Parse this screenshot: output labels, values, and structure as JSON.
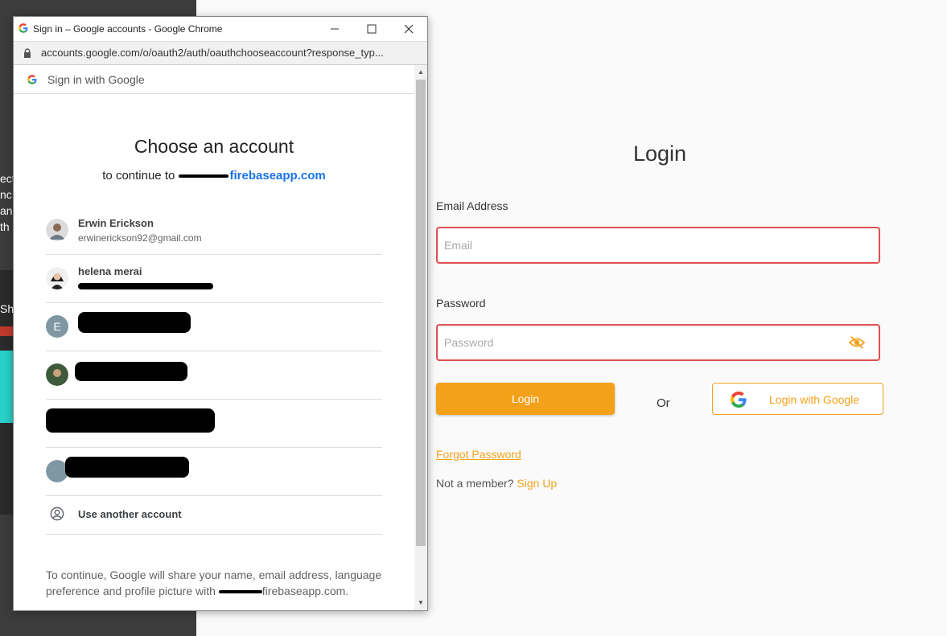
{
  "background": {
    "left_text_lines": [
      "ect",
      "nc",
      "an",
      "th"
    ],
    "tab_snippet": "Sh"
  },
  "login": {
    "title": "Login",
    "email_label": "Email Address",
    "email_placeholder": "Email",
    "password_label": "Password",
    "password_placeholder": "Password",
    "login_button": "Login",
    "or_text": "Or",
    "google_button": "Login with Google",
    "forgot_password": "Forgot Password",
    "not_member": "Not a member?",
    "sign_up": "Sign Up",
    "accent_color": "#f4a11a",
    "error_border_color": "#e05050"
  },
  "popup": {
    "window_title": "Sign in – Google accounts - Google Chrome",
    "url": "accounts.google.com/o/oauth2/auth/oauthchooseaccount?response_typ...",
    "header": "Sign in with Google",
    "heading": "Choose an account",
    "continue_prefix": "to continue to",
    "continue_app": "firebaseapp.com",
    "accounts": [
      {
        "name": "Erwin Erickson",
        "email": "erwinerickson92@gmail.com"
      },
      {
        "name": "helena merai",
        "email": ""
      },
      {
        "name": "",
        "email": "",
        "initial": "E"
      },
      {
        "name": "",
        "email": ""
      },
      {
        "name": "",
        "email": ""
      },
      {
        "name": "",
        "email": ""
      }
    ],
    "use_another": "Use another account",
    "footer": "To continue, Google will share your name, email address, language preference and profile picture with",
    "footer_app": "firebaseapp.com."
  }
}
